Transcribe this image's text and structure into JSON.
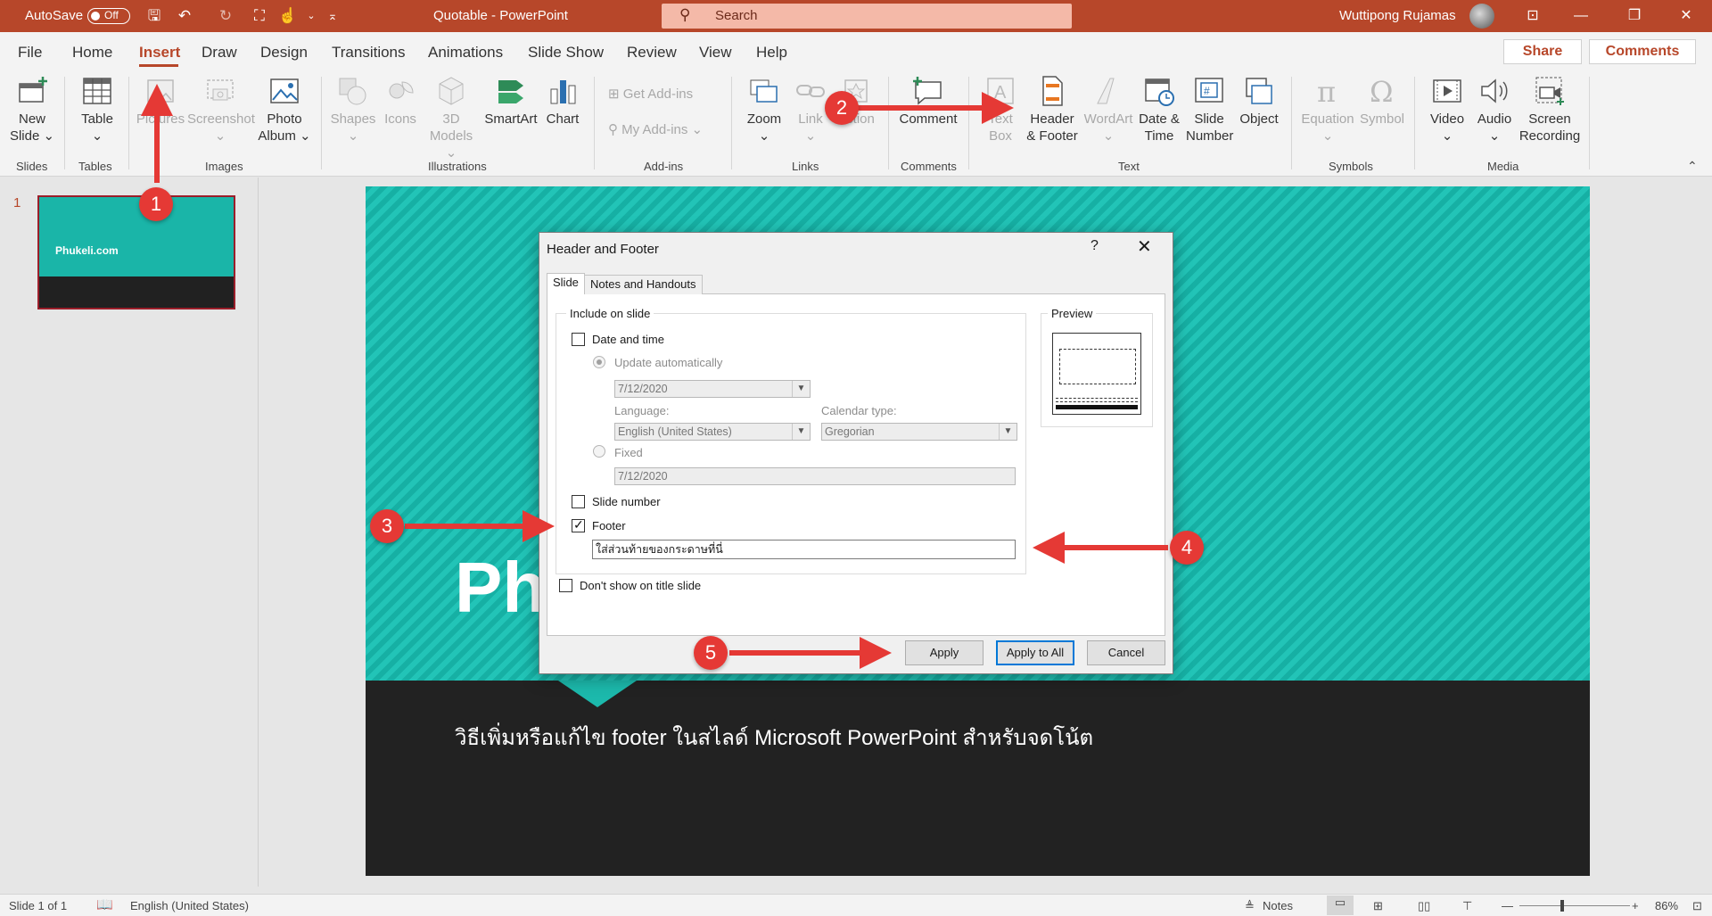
{
  "titlebar": {
    "autosave_label": "AutoSave",
    "autosave_state": "Off",
    "doc_title": "Quotable  -  PowerPoint",
    "search_placeholder": "Search",
    "user_name": "Wuttipong Rujamas"
  },
  "menu": {
    "tabs": [
      "File",
      "Home",
      "Insert",
      "Draw",
      "Design",
      "Transitions",
      "Animations",
      "Slide Show",
      "Review",
      "View",
      "Help"
    ],
    "active": "Insert",
    "share": "Share",
    "comments": "Comments"
  },
  "ribbon": {
    "new_slide": [
      "New",
      "Slide"
    ],
    "table": "Table",
    "pictures": "Pictures",
    "screenshot": "Screenshot",
    "photo_album": [
      "Photo",
      "Album"
    ],
    "shapes": "Shapes",
    "icons": "Icons",
    "models": [
      "3D",
      "Models"
    ],
    "smartart": "SmartArt",
    "chart": "Chart",
    "get_addins": "Get Add-ins",
    "my_addins": "My Add-ins",
    "zoom": "Zoom",
    "link": "Link",
    "action": "Action",
    "comment": "Comment",
    "text_box": [
      "Text",
      "Box"
    ],
    "header_footer": [
      "Header",
      "& Footer"
    ],
    "wordart": "WordArt",
    "date_time": [
      "Date &",
      "Time"
    ],
    "slide_number": [
      "Slide",
      "Number"
    ],
    "object": "Object",
    "equation": "Equation",
    "symbol": "Symbol",
    "video": "Video",
    "audio": "Audio",
    "screen_recording": [
      "Screen",
      "Recording"
    ],
    "groups": {
      "slides": "Slides",
      "tables": "Tables",
      "images": "Images",
      "illustrations": "Illustrations",
      "addins": "Add-ins",
      "links": "Links",
      "comments": "Comments",
      "text": "Text",
      "symbols": "Symbols",
      "media": "Media"
    }
  },
  "thumbnail": {
    "number": "1",
    "title": "Phukeli.com"
  },
  "slide": {
    "title": "Ph",
    "footer": "วิธีเพิ่มหรือแก้ไข footer ในสไลด์ Microsoft PowerPoint สำหรับจดโน้ต"
  },
  "dialog": {
    "title": "Header and Footer",
    "help": "?",
    "close": "✕",
    "tab_slide": "Slide",
    "tab_notes": "Notes and Handouts",
    "include_legend": "Include on slide",
    "date_time": "Date and time",
    "update_auto": "Update automatically",
    "date_value": "7/12/2020",
    "language_label": "Language:",
    "language_value": "English (United States)",
    "calendar_label": "Calendar type:",
    "calendar_value": "Gregorian",
    "fixed": "Fixed",
    "fixed_value": "7/12/2020",
    "slide_number": "Slide number",
    "footer": "Footer",
    "footer_checked": true,
    "footer_value": "ใส่ส่วนท้ายของกระดาษที่นี่",
    "dont_show": "Don't show on title slide",
    "preview_legend": "Preview",
    "apply": "Apply",
    "apply_all": "Apply to All",
    "cancel": "Cancel"
  },
  "annotations": [
    "1",
    "2",
    "3",
    "4",
    "5"
  ],
  "annotation_color": "#e53935",
  "statusbar": {
    "slide_info": "Slide 1 of 1",
    "language": "English (United States)",
    "notes": "Notes",
    "zoom": "86%"
  }
}
